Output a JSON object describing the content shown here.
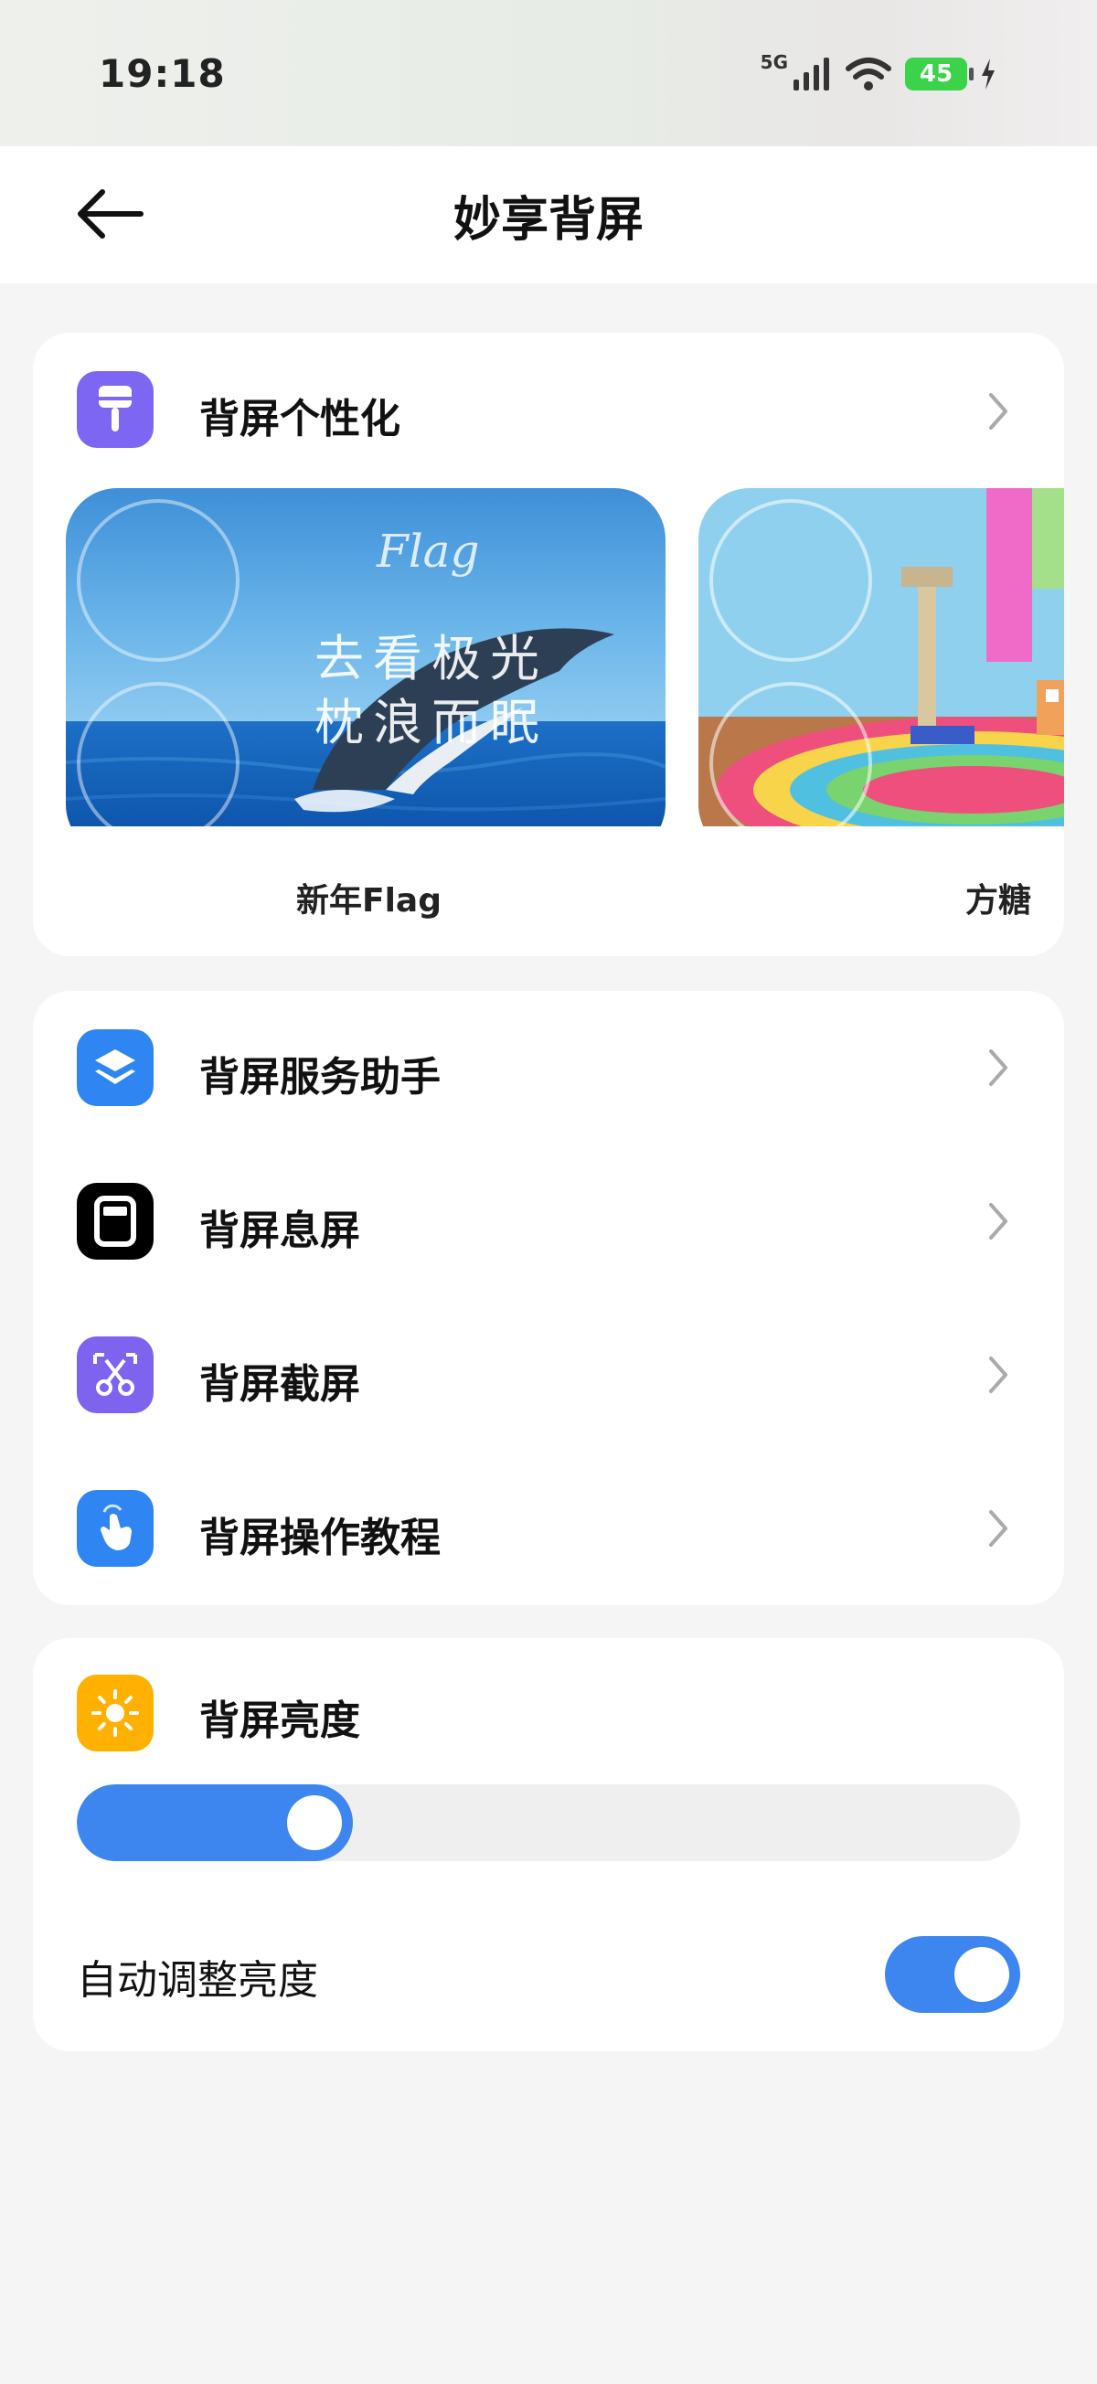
{
  "status_bar": {
    "time": "19:18",
    "network": "5G",
    "battery": "45"
  },
  "header": {
    "title": "妙享背屏"
  },
  "personalization": {
    "label": "背屏个性化",
    "icon": "paint-brush-icon",
    "icon_color": "#7d67f2",
    "wallpapers": [
      {
        "name": "新年Flag",
        "overlay_script": "Flag",
        "overlay_line1": "去看极光",
        "overlay_line2": "枕浪而眠"
      },
      {
        "name": "方糖"
      }
    ]
  },
  "services": {
    "items": [
      {
        "label": "背屏服务助手",
        "icon": "layers-icon",
        "icon_color": "#2f86f2"
      },
      {
        "label": "背屏息屏",
        "icon": "screen-off-icon",
        "icon_color": "#000000"
      },
      {
        "label": "背屏截屏",
        "icon": "scissors-icon",
        "icon_color": "#7d63ee"
      },
      {
        "label": "背屏操作教程",
        "icon": "hand-tap-icon",
        "icon_color": "#2f86f2"
      }
    ]
  },
  "brightness": {
    "label": "背屏亮度",
    "icon": "sun-icon",
    "icon_color": "#ffb000",
    "level_percent": 23,
    "auto_label": "自动调整亮度",
    "auto_enabled": true
  },
  "accent_color": "#3d86f0"
}
